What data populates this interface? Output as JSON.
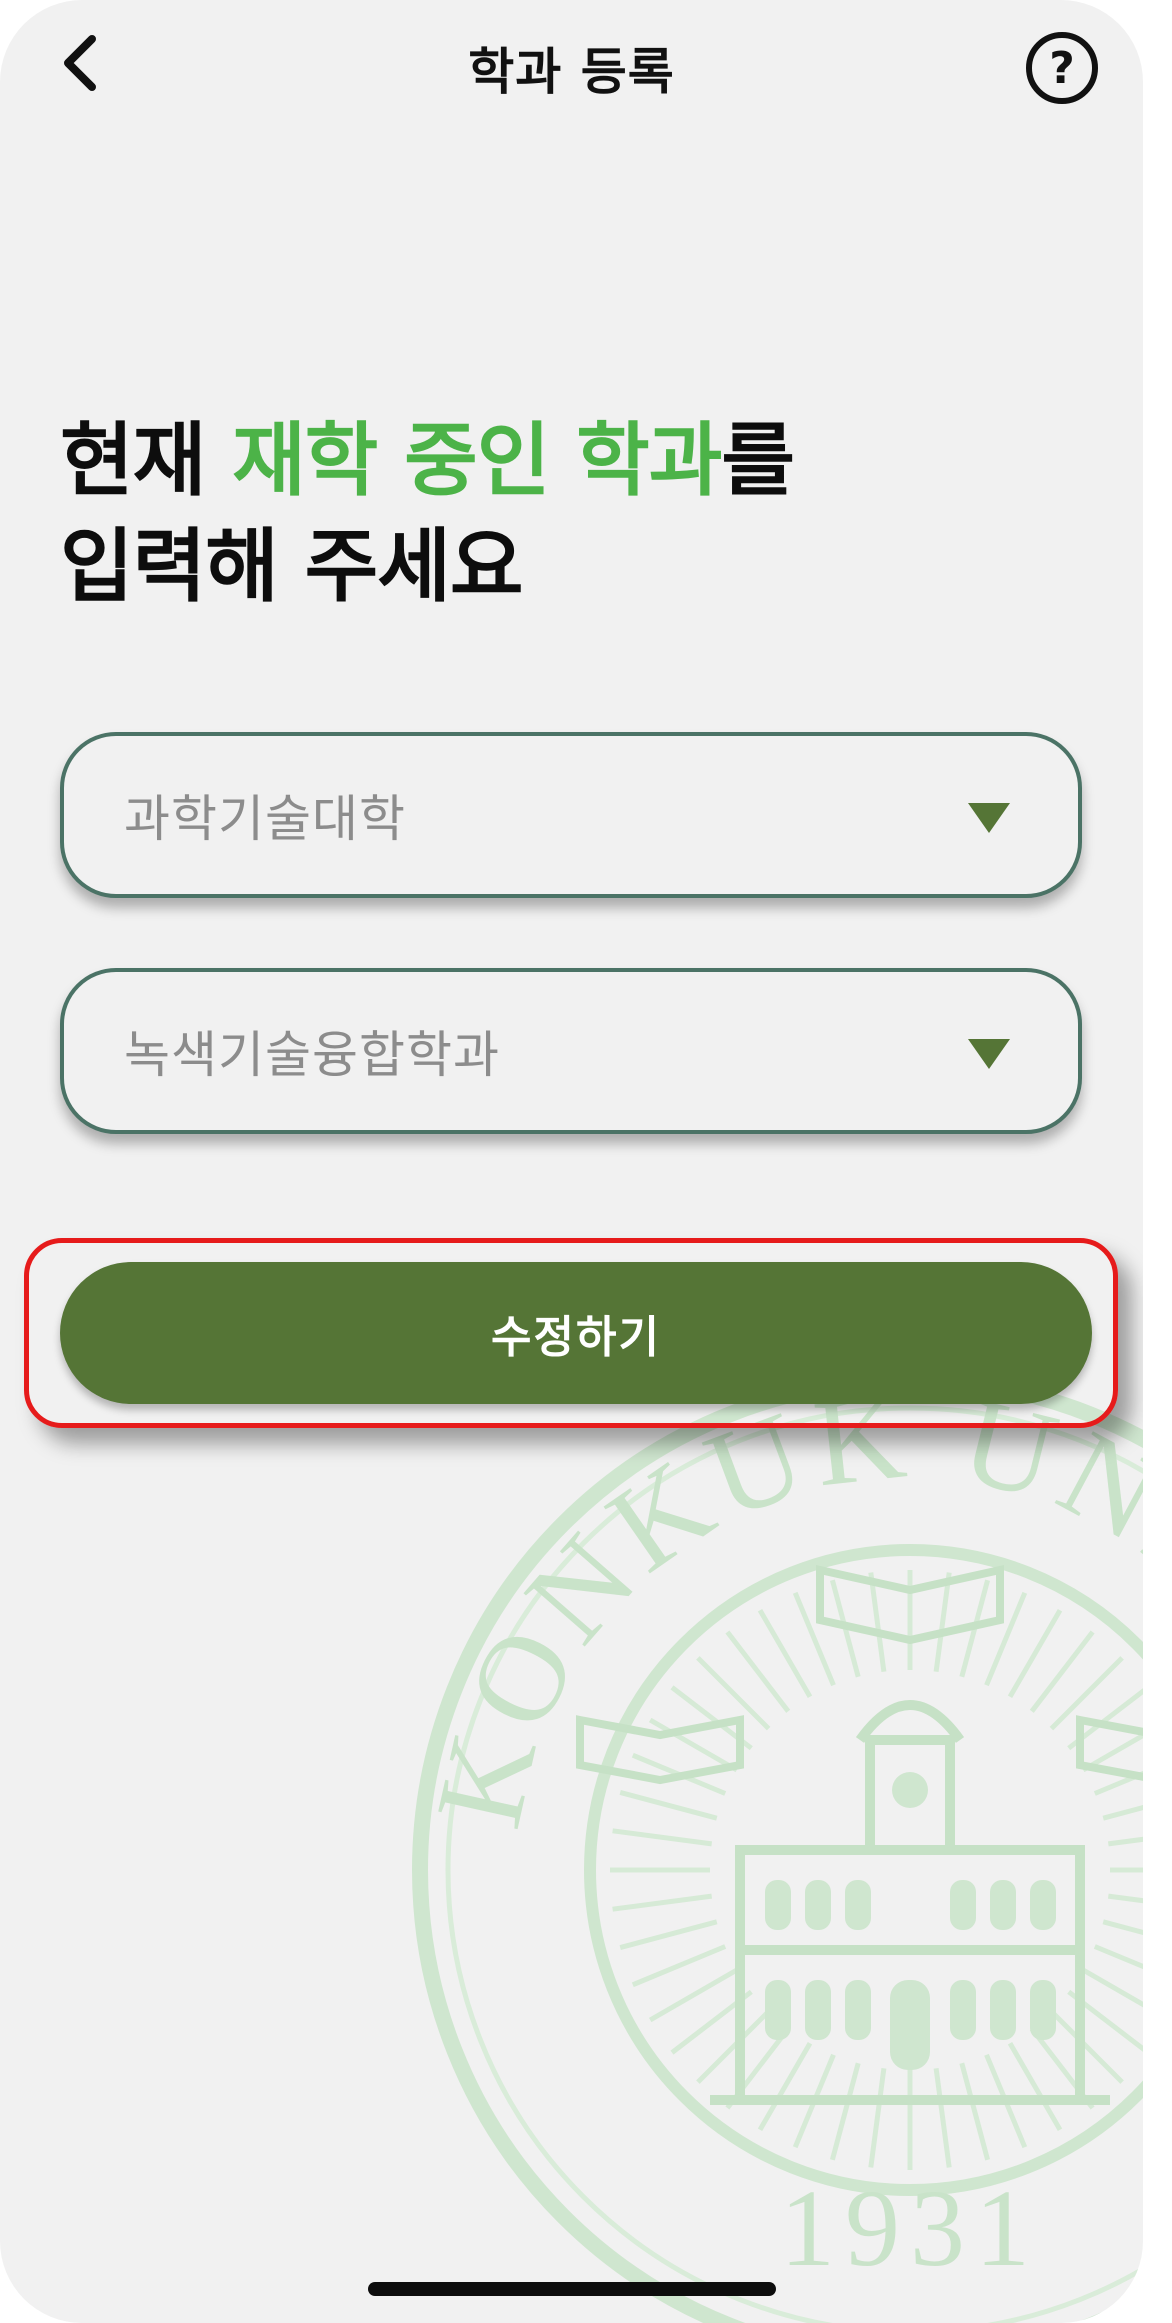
{
  "header": {
    "title": "학과 등록",
    "back_icon": "chevron-left-icon",
    "help_icon": "question-circle-icon"
  },
  "heading": {
    "line1_prefix": "현재 ",
    "line1_accent": "재학 중인 학과",
    "line1_suffix": "를",
    "line2": "입력해 주세요"
  },
  "form": {
    "college_select": {
      "value": "과학기술대학",
      "icon": "triangle-down-icon"
    },
    "department_select": {
      "value": "녹색기술융합학과",
      "icon": "triangle-down-icon"
    },
    "submit_label": "수정하기"
  },
  "watermark": {
    "arc_text": "KONKUK UNIVERSITY",
    "year": "1931"
  },
  "colors": {
    "accent_green": "#4cb348",
    "button_green": "#557536",
    "border_teal": "#4b7366",
    "highlight_red": "#e61b1b",
    "background": "#f1f1f1",
    "seal_green": "#cfe6cf"
  }
}
